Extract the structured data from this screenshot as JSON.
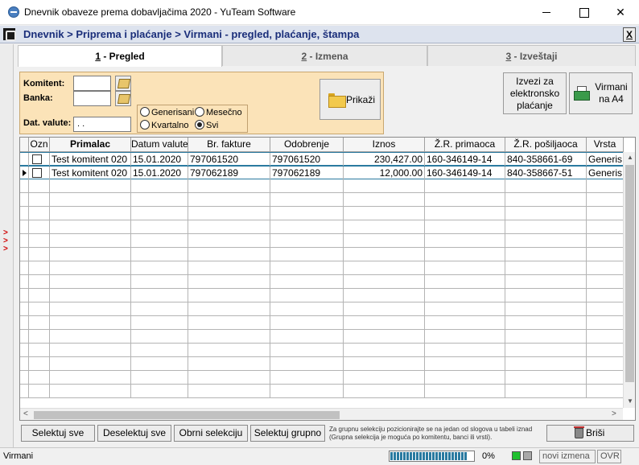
{
  "window": {
    "title": "Dnevnik obaveze prema dobavljačima 2020 - YuTeam Software"
  },
  "breadcrumb": {
    "text": "Dnevnik > Priprema i plaćanje > Virmani - pregled, plaćanje, štampa",
    "close_label": "X"
  },
  "left_strip": {
    "arrows": ">\n>\n>"
  },
  "tabs": [
    {
      "hotkey": "1",
      "label": " - Pregled"
    },
    {
      "hotkey": "2",
      "label": " - Izmena"
    },
    {
      "hotkey": "3",
      "label": " - Izveštaji"
    }
  ],
  "filter": {
    "komitent_label": "Komitent:",
    "komitent_value": "",
    "banka_label": "Banka:",
    "banka_value": "",
    "dat_valute_label": "Dat. valute:",
    "dat_valute_value": " .  .",
    "radios": {
      "generisani": "Generisani",
      "mesecno": "Mesečno",
      "kvartalno": "Kvartalno",
      "svi": "Svi",
      "selected": "svi"
    },
    "prikazi_label": "Prikaži"
  },
  "actions": {
    "izvezi_line1": "Izvezi za",
    "izvezi_line2": "elektronsko",
    "izvezi_line3": "plaćanje",
    "virmani_line1": "Virmani",
    "virmani_line2": "na A4"
  },
  "grid": {
    "columns": [
      "Ozn",
      "Primalac",
      "Datum valute",
      "Br. fakture",
      "Odobrenje",
      "Iznos",
      "Ž.R. primaoca",
      "Ž.R. pošiljaoca",
      "Vrsta"
    ],
    "rows": [
      [
        "",
        "Test komitent 020",
        "15.01.2020",
        "797061520",
        "797061520",
        "230,427.00",
        "160-346149-14",
        "840-358661-69",
        "Generis"
      ],
      [
        "",
        "Test komitent 020",
        "15.01.2020",
        "797062189",
        "797062189",
        "12,000.00",
        "160-346149-14",
        "840-358667-51",
        "Generis"
      ]
    ],
    "current_row": 1
  },
  "bottom": {
    "selektuj_sve": "Selektuj sve",
    "deselektuj_sve": "Deselektuj sve",
    "obrni_selekciju": "Obrni selekciju",
    "selektuj_grupno": "Selektuj grupno",
    "hint_line1": "Za grupnu selekciju pozicionirajte se na jedan od slogova u tabeli iznad",
    "hint_line2": "(Grupna selekcija je moguća po komitentu, banci ili vrsti).",
    "brisi_label": "Briši"
  },
  "status": {
    "left_text": "Virmani",
    "progress_percent": 0.93,
    "percent_label": "0%",
    "izmena_label": "novi izmena",
    "ovr_label": "OVR",
    "indicator_colors": {
      "green": "#20c030",
      "gray": "#a8a8a8"
    }
  }
}
